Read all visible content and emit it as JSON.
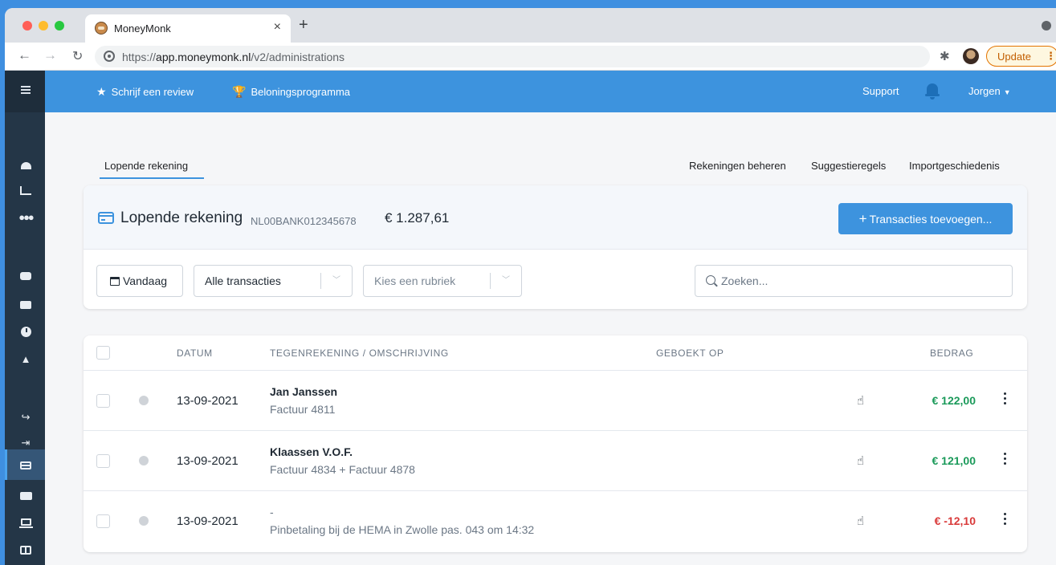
{
  "browser": {
    "tab_title": "MoneyMonk",
    "tab_close": "×",
    "new_tab": "+",
    "url_prefix": "https://",
    "url_host": "app.moneymonk.nl",
    "url_path": "/v2/administrations",
    "update_label": "Update",
    "update_menu": "⋮"
  },
  "topnav": {
    "review_label": "Schrijf een review",
    "rewards_label": "Beloningsprogramma",
    "support_label": "Support",
    "user_label": "Jorgen"
  },
  "sidebar": {
    "items": [
      {
        "icon": "dashboard-gauge-icon"
      },
      {
        "icon": "chart-icon"
      },
      {
        "icon": "users-icon"
      },
      {
        "icon": "inbox-icon"
      },
      {
        "icon": "folder-icon"
      },
      {
        "icon": "clock-icon"
      },
      {
        "icon": "road-icon"
      },
      {
        "icon": "sign-out-icon"
      },
      {
        "icon": "sign-in-icon"
      },
      {
        "icon": "credit-card-icon",
        "active": true
      },
      {
        "icon": "bill-icon"
      },
      {
        "icon": "laptop-icon"
      },
      {
        "icon": "columns-icon"
      }
    ]
  },
  "tabs": {
    "current": "Lopende rekening",
    "manage": "Rekeningen beheren",
    "suggest": "Suggestieregels",
    "history": "Importgeschiedenis"
  },
  "account": {
    "title": "Lopende rekening",
    "iban": "NL00BANK012345678",
    "balance": "€ 1.287,61",
    "add_button": "Transacties toevoegen..."
  },
  "filters": {
    "today_label": "Vandaag",
    "type_select": "Alle transacties",
    "rubric_placeholder": "Kies een rubriek",
    "search_placeholder": "Zoeken..."
  },
  "table": {
    "headers": {
      "date": "DATUM",
      "description": "TEGENREKENING / OMSCHRIJVING",
      "booked": "GEBOEKT OP",
      "amount": "BEDRAG"
    },
    "rows": [
      {
        "date": "13-09-2021",
        "name": "Jan Janssen",
        "description": "Factuur 4811",
        "amount": "€ 122,00",
        "sign": "positive"
      },
      {
        "date": "13-09-2021",
        "name": "Klaassen V.O.F.",
        "description": "Factuur 4834 + Factuur 4878",
        "amount": "€ 121,00",
        "sign": "positive"
      },
      {
        "date": "13-09-2021",
        "name": "-",
        "description": "Pinbetaling bij de HEMA in Zwolle pas. 043 om 14:32",
        "amount": "€ -12,10",
        "sign": "negative"
      }
    ]
  },
  "colors": {
    "accent": "#3d93de",
    "sidebar": "#243647",
    "positive": "#1b9a5a",
    "negative": "#d93a3a"
  }
}
